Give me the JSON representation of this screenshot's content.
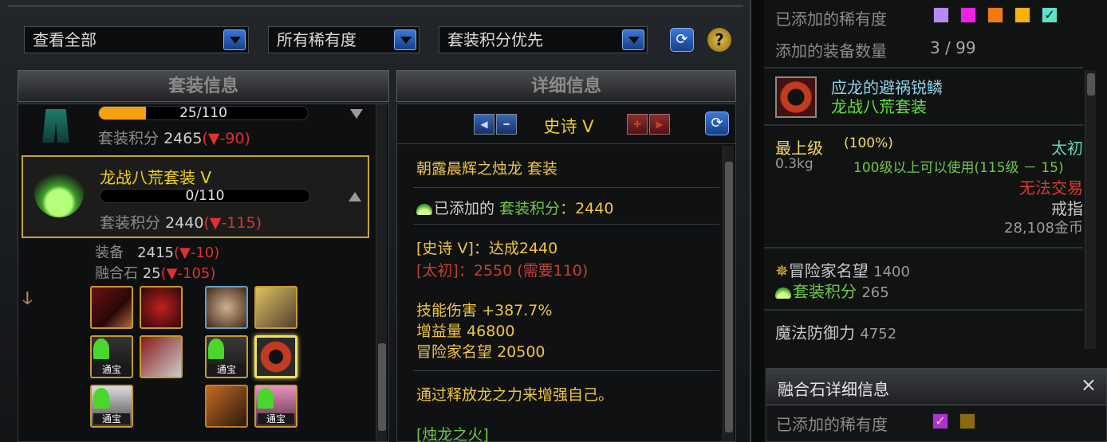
{
  "filters": {
    "view": "查看全部",
    "rarity": "所有稀有度",
    "sort": "套装积分优先"
  },
  "headers": {
    "set_info": "套装信息",
    "detail_info": "详细信息"
  },
  "set_list": [
    {
      "progress": "25/110",
      "progress_fraction": 0.227,
      "score_label": "套装积分",
      "score": "2465",
      "delta": "(▼-90)"
    },
    {
      "name": "龙战八荒套装 Ⅴ",
      "progress": "0/110",
      "progress_fraction": 0.0,
      "score_label": "套装积分",
      "score": "2440",
      "delta": "(▼-115)",
      "equip_label": "装备",
      "equip_score": "2415",
      "equip_delta": "(▼-10)",
      "fusion_label": "融合石",
      "fusion_score": "25",
      "fusion_delta": "(▼-105)"
    }
  ],
  "item_tag": "通宝",
  "detail": {
    "tier": "史诗 Ⅴ",
    "set_title": "朝露晨辉之烛龙  套装",
    "added_prefix": "已添加的",
    "added_label": "套装积分",
    "added_value": "：2440",
    "epic_line": "[史诗 Ⅴ]：达成2440",
    "taichu_line": "[太初]：2550 (需要110)",
    "skill_damage_label": "技能伤害",
    "skill_damage_value": "+387.7%",
    "buff_label": "增益量",
    "buff_value": "46800",
    "fame_label": "冒险家名望",
    "fame_value": "20500",
    "desc": "通过释放龙之力来增强自己。",
    "sub_title": "[烛龙之火]"
  },
  "tooltip": {
    "added_rarity_label": "已添加的稀有度",
    "added_count_label": "添加的装备数量",
    "added_count": "3  /  99",
    "item_name": "应龙的避祸锐鳞",
    "item_set": "龙战八荒套装",
    "grade": "最上级",
    "grade_pct": "(100%)",
    "rarity": "太初",
    "weight": "0.3kg",
    "level_req": "100级以上可以使用(115级 － 15)",
    "trade": "无法交易",
    "slot": "戒指",
    "price": "28,108金币",
    "fame_label": "冒险家名望",
    "fame": "1400",
    "set_score_label": "套装积分",
    "set_score": "265",
    "magic_def_label": "魔法防御力",
    "magic_def": "4752",
    "rarity_colors": [
      "#b88af5",
      "#f020e6",
      "#f07a14",
      "#f6b300",
      "#5fe0c8"
    ]
  },
  "fusion": {
    "title": "融合石详细信息",
    "close": "×",
    "added_rarity_label": "已添加的稀有度",
    "rarity_colors": [
      "#b030d8",
      "#8a6b12"
    ]
  }
}
